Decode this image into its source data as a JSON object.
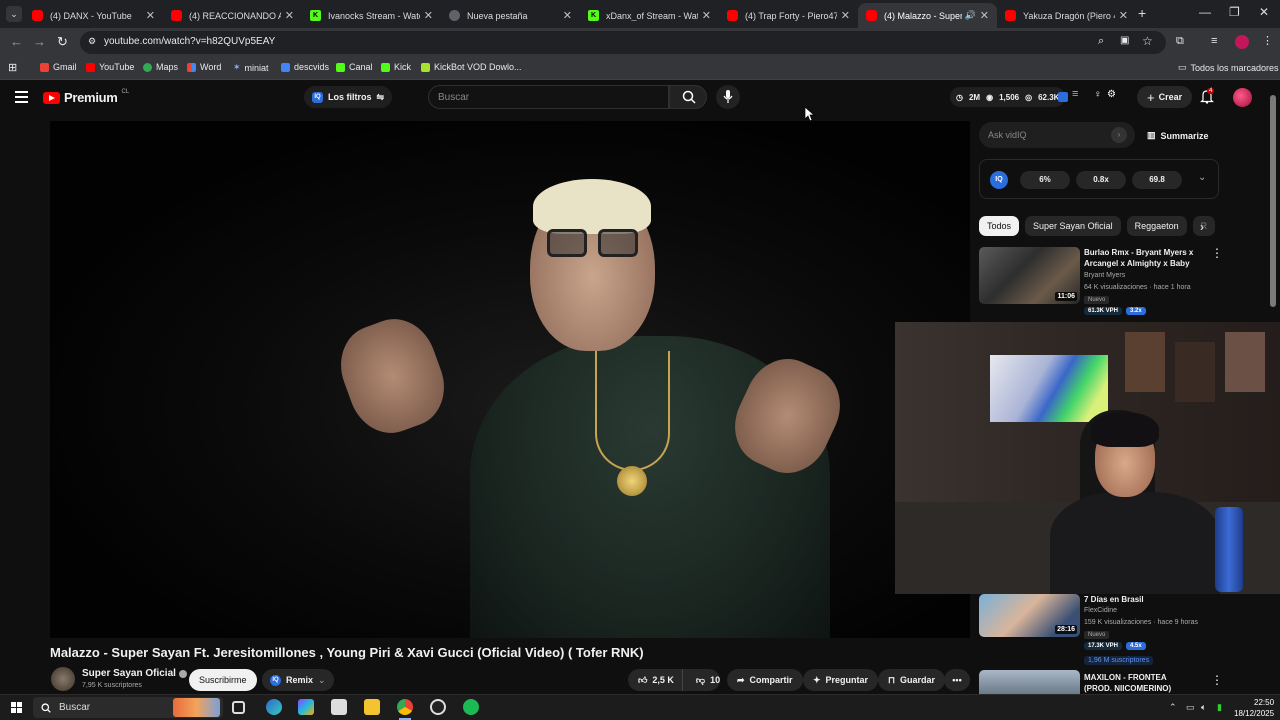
{
  "browser": {
    "tabs": [
      {
        "title": "(4) DANX - YouTube",
        "icon": "yt"
      },
      {
        "title": "(4) REACCIONANDO AL A",
        "icon": "yt"
      },
      {
        "title": "Ivanocks Stream - Watch",
        "icon": "kick"
      },
      {
        "title": "Nueva pestaña",
        "icon": "chrome"
      },
      {
        "title": "xDanx_of Stream - Watch",
        "icon": "kick"
      },
      {
        "title": "(4) Trap Forty - Piero47 X",
        "icon": "yt"
      },
      {
        "title": "(4) Malazzo - Super S",
        "icon": "yt",
        "active": true
      },
      {
        "title": "Yakuza Dragón (Piero 47",
        "icon": "yt"
      }
    ],
    "url": "youtube.com/watch?v=h82QUVp5EAY",
    "bookmarks": [
      "Gmail",
      "YouTube",
      "Maps",
      "Word",
      "miniat",
      "descvids",
      "Canal",
      "Kick",
      "KickBot VOD Dowlo..."
    ],
    "all_bookmarks": "Todos los marcadores"
  },
  "youtube": {
    "logo_text": "Premium",
    "logo_region": "CL",
    "filters_label": "Los filtros",
    "search_placeholder": "Buscar",
    "header_stats": {
      "a": "2M",
      "b": "1,506",
      "c": "62.3K"
    },
    "create_label": "Crear",
    "notifications": "4"
  },
  "video": {
    "title": "Malazzo - Super Sayan Ft. Jeresitomillones , Young Piri & Xavi Gucci (Oficial Video) ( Tofer RNK)",
    "channel": "Super Sayan Oficial",
    "subscribers": "7,95 K suscriptores",
    "subscribe_label": "Suscribirme",
    "remix_label": "Remix",
    "likes": "2,5 K",
    "dislikes": "10",
    "share_label": "Compartir",
    "ask_label": "Preguntar",
    "save_label": "Guardar"
  },
  "sidebar": {
    "ask_placeholder": "Ask vidIQ",
    "summarize_label": "Summarize",
    "iq_logo": "IQ",
    "iq_stats": [
      "6%",
      "0.8x",
      "69.8"
    ],
    "chips": [
      "Todos",
      "Super Sayan Oficial",
      "Reggaeton",
      "R"
    ],
    "recommendations": [
      {
        "title": "Burlao Rmx - Bryant Myers x Arcangel x Almighty x Baby ...",
        "channel": "Bryant Myers",
        "meta": "64 K visualizaciones · hace 1 hora",
        "badge": "Nuevo",
        "duration": "11:06",
        "vph": "61.3K VPH",
        "ratio": "3.2x"
      },
      {
        "title": "7 Días en Brasil",
        "channel": "FlexCidine",
        "meta": "159 K visualizaciones · hace 9 horas",
        "badge": "Nuevo",
        "duration": "28:16",
        "vph": "17.3K VPH",
        "ratio": "4.5x",
        "subs": "1,96 M suscriptores"
      },
      {
        "title": "MAXILON - FRONTEA (PROD. NIICOMERINO)"
      }
    ]
  },
  "taskbar": {
    "search_placeholder": "Buscar",
    "time": "22:50",
    "date": "18/12/2025"
  },
  "colors": {
    "yt_red": "#ff0000",
    "kick_green": "#53fc18",
    "vidiq_blue": "#2c6dde",
    "background": "#0f0f0f"
  }
}
